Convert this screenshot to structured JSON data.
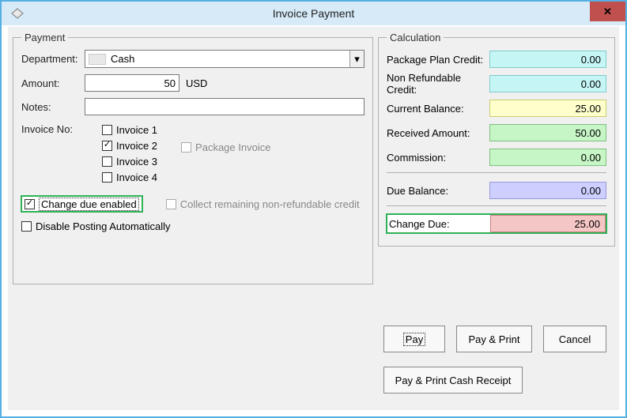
{
  "window": {
    "title": "Invoice Payment"
  },
  "payment": {
    "legend": "Payment",
    "department_label": "Department:",
    "department_value": "Cash",
    "amount_label": "Amount:",
    "amount_value": "50",
    "currency": "USD",
    "notes_label": "Notes:",
    "notes_value": "",
    "invoice_no_label": "Invoice No:",
    "invoices": [
      "Invoice 1",
      "Invoice 2",
      "Invoice 3",
      "Invoice 4"
    ],
    "package_invoice_label": "Package Invoice",
    "change_due_enabled_label": "Change due enabled",
    "collect_remaining_label": "Collect remaining non-refundable credit",
    "disable_posting_label": "Disable Posting Automatically"
  },
  "calculation": {
    "legend": "Calculation",
    "rows": {
      "package_plan_credit": {
        "label": "Package Plan Credit:",
        "value": "0.00"
      },
      "non_refundable_credit": {
        "label": "Non Refundable Credit:",
        "value": "0.00"
      },
      "current_balance": {
        "label": "Current Balance:",
        "value": "25.00"
      },
      "received_amount": {
        "label": "Received Amount:",
        "value": "50.00"
      },
      "commission": {
        "label": "Commission:",
        "value": "0.00"
      },
      "due_balance": {
        "label": "Due Balance:",
        "value": "0.00"
      },
      "change_due": {
        "label": "Change Due:",
        "value": "25.00"
      }
    }
  },
  "buttons": {
    "pay": "Pay",
    "pay_print": "Pay & Print",
    "cancel": "Cancel",
    "pay_print_cash_receipt": "Pay & Print Cash Receipt"
  }
}
